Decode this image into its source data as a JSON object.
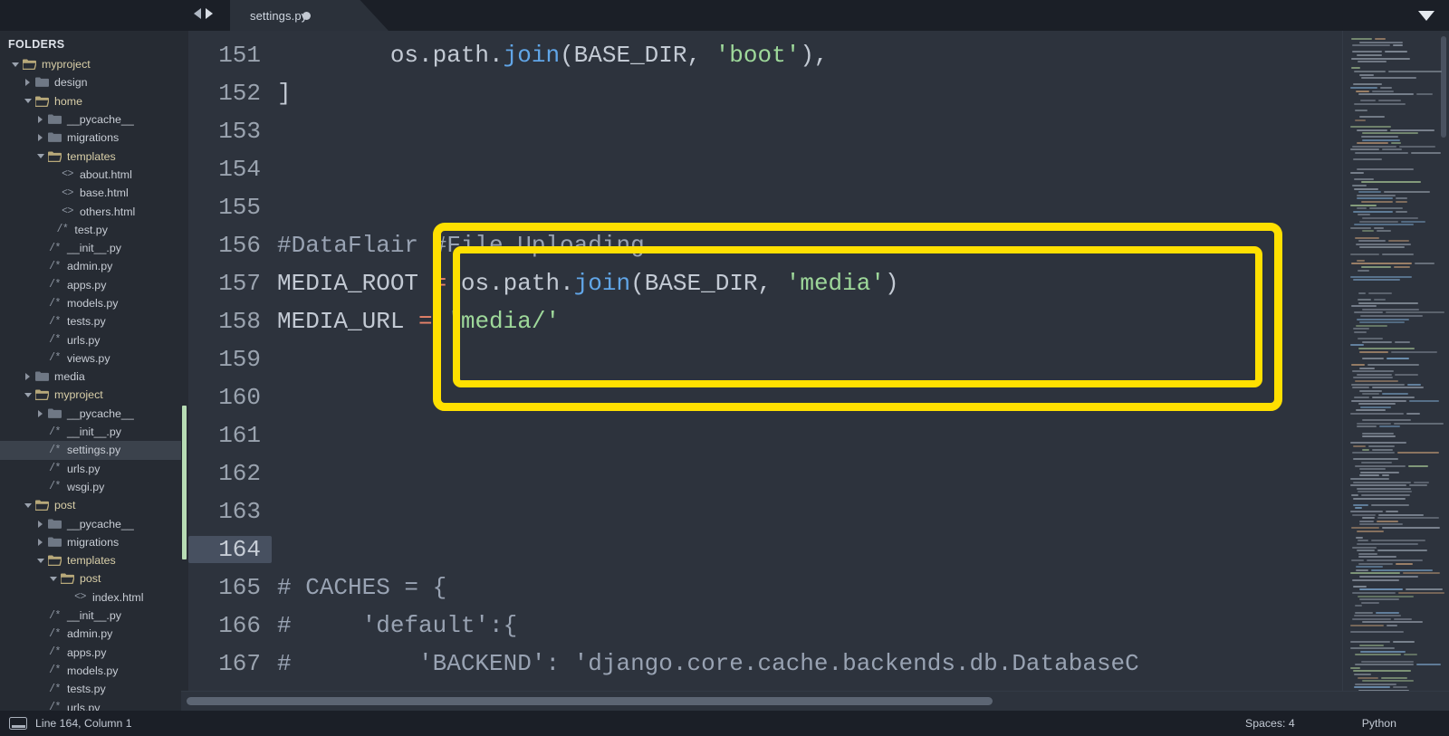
{
  "window": {
    "tab_label": "settings.py",
    "tab_modified_indicator": "unsaved-dot",
    "nav_back_icon": "arrow-left-icon",
    "nav_forward_icon": "arrow-right-icon",
    "menu_chevron_icon": "chevron-down-icon"
  },
  "sidebar": {
    "title": "FOLDERS",
    "items": [
      {
        "label": "myproject",
        "depth": 0,
        "kind": "folder",
        "state": "open",
        "icon": "folder-open-icon"
      },
      {
        "label": "design",
        "depth": 1,
        "kind": "folder",
        "state": "closed",
        "icon": "folder-icon"
      },
      {
        "label": "home",
        "depth": 1,
        "kind": "folder",
        "state": "open",
        "icon": "folder-open-icon"
      },
      {
        "label": "__pycache__",
        "depth": 2,
        "kind": "folder",
        "state": "closed",
        "icon": "folder-icon"
      },
      {
        "label": "migrations",
        "depth": 2,
        "kind": "folder",
        "state": "closed",
        "icon": "folder-icon"
      },
      {
        "label": "templates",
        "depth": 2,
        "kind": "folder",
        "state": "open",
        "icon": "folder-open-icon"
      },
      {
        "label": "about.html",
        "depth": 3,
        "kind": "file",
        "state": "",
        "icon": "html-file-icon"
      },
      {
        "label": "base.html",
        "depth": 3,
        "kind": "file",
        "state": "",
        "icon": "html-file-icon"
      },
      {
        "label": "others.html",
        "depth": 3,
        "kind": "file",
        "state": "",
        "icon": "html-file-icon"
      },
      {
        "label": "test.py",
        "depth": 2.6,
        "kind": "file",
        "state": "",
        "icon": "python-file-icon"
      },
      {
        "label": "__init__.py",
        "depth": 2,
        "kind": "file",
        "state": "",
        "icon": "python-file-icon"
      },
      {
        "label": "admin.py",
        "depth": 2,
        "kind": "file",
        "state": "",
        "icon": "python-file-icon"
      },
      {
        "label": "apps.py",
        "depth": 2,
        "kind": "file",
        "state": "",
        "icon": "python-file-icon"
      },
      {
        "label": "models.py",
        "depth": 2,
        "kind": "file",
        "state": "",
        "icon": "python-file-icon"
      },
      {
        "label": "tests.py",
        "depth": 2,
        "kind": "file",
        "state": "",
        "icon": "python-file-icon"
      },
      {
        "label": "urls.py",
        "depth": 2,
        "kind": "file",
        "state": "",
        "icon": "python-file-icon"
      },
      {
        "label": "views.py",
        "depth": 2,
        "kind": "file",
        "state": "",
        "icon": "python-file-icon"
      },
      {
        "label": "media",
        "depth": 1,
        "kind": "folder",
        "state": "closed",
        "icon": "folder-icon"
      },
      {
        "label": "myproject",
        "depth": 1,
        "kind": "folder",
        "state": "open",
        "icon": "folder-open-icon"
      },
      {
        "label": "__pycache__",
        "depth": 2,
        "kind": "folder",
        "state": "closed",
        "icon": "folder-icon"
      },
      {
        "label": "__init__.py",
        "depth": 2,
        "kind": "file",
        "state": "",
        "icon": "python-file-icon"
      },
      {
        "label": "settings.py",
        "depth": 2,
        "kind": "file",
        "state": "selected",
        "icon": "python-file-icon"
      },
      {
        "label": "urls.py",
        "depth": 2,
        "kind": "file",
        "state": "",
        "icon": "python-file-icon"
      },
      {
        "label": "wsgi.py",
        "depth": 2,
        "kind": "file",
        "state": "",
        "icon": "python-file-icon"
      },
      {
        "label": "post",
        "depth": 1,
        "kind": "folder",
        "state": "open",
        "icon": "folder-open-icon"
      },
      {
        "label": "__pycache__",
        "depth": 2,
        "kind": "folder",
        "state": "closed",
        "icon": "folder-icon"
      },
      {
        "label": "migrations",
        "depth": 2,
        "kind": "folder",
        "state": "closed",
        "icon": "folder-icon"
      },
      {
        "label": "templates",
        "depth": 2,
        "kind": "folder",
        "state": "open",
        "icon": "folder-open-icon"
      },
      {
        "label": "post",
        "depth": 3,
        "kind": "folder",
        "state": "open",
        "icon": "folder-open-icon"
      },
      {
        "label": "index.html",
        "depth": 4,
        "kind": "file",
        "state": "",
        "icon": "html-file-icon"
      },
      {
        "label": "__init__.py",
        "depth": 2,
        "kind": "file",
        "state": "",
        "icon": "python-file-icon"
      },
      {
        "label": "admin.py",
        "depth": 2,
        "kind": "file",
        "state": "",
        "icon": "python-file-icon"
      },
      {
        "label": "apps.py",
        "depth": 2,
        "kind": "file",
        "state": "",
        "icon": "python-file-icon"
      },
      {
        "label": "models.py",
        "depth": 2,
        "kind": "file",
        "state": "",
        "icon": "python-file-icon"
      },
      {
        "label": "tests.py",
        "depth": 2,
        "kind": "file",
        "state": "",
        "icon": "python-file-icon"
      },
      {
        "label": "urls.py",
        "depth": 2,
        "kind": "file",
        "state": "",
        "icon": "python-file-icon"
      }
    ]
  },
  "editor": {
    "current_line": 164,
    "first_visible_line": 151,
    "lines": [
      {
        "n": 151,
        "tokens": [
          {
            "t": "        os.path.",
            "c": "pln"
          },
          {
            "t": "join",
            "c": "fn"
          },
          {
            "t": "(BASE_DIR, ",
            "c": "pln"
          },
          {
            "t": "'boot'",
            "c": "str"
          },
          {
            "t": "),",
            "c": "pln"
          }
        ]
      },
      {
        "n": 152,
        "tokens": [
          {
            "t": "]",
            "c": "pln"
          }
        ]
      },
      {
        "n": 153,
        "tokens": []
      },
      {
        "n": 154,
        "tokens": []
      },
      {
        "n": 155,
        "tokens": []
      },
      {
        "n": 156,
        "tokens": [
          {
            "t": "#DataFlair #File Uploading",
            "c": "com"
          }
        ]
      },
      {
        "n": 157,
        "tokens": [
          {
            "t": "MEDIA_ROOT ",
            "c": "pln"
          },
          {
            "t": "=",
            "c": "op"
          },
          {
            "t": " os.path.",
            "c": "pln"
          },
          {
            "t": "join",
            "c": "fn"
          },
          {
            "t": "(BASE_DIR, ",
            "c": "pln"
          },
          {
            "t": "'media'",
            "c": "str"
          },
          {
            "t": ")",
            "c": "pln"
          }
        ]
      },
      {
        "n": 158,
        "tokens": [
          {
            "t": "MEDIA_URL ",
            "c": "pln"
          },
          {
            "t": "=",
            "c": "op"
          },
          {
            "t": " ",
            "c": "pln"
          },
          {
            "t": "'media/'",
            "c": "str"
          }
        ]
      },
      {
        "n": 159,
        "tokens": []
      },
      {
        "n": 160,
        "tokens": []
      },
      {
        "n": 161,
        "tokens": []
      },
      {
        "n": 162,
        "tokens": []
      },
      {
        "n": 163,
        "tokens": []
      },
      {
        "n": 164,
        "tokens": []
      },
      {
        "n": 165,
        "tokens": [
          {
            "t": "# CACHES = {",
            "c": "com"
          }
        ]
      },
      {
        "n": 166,
        "tokens": [
          {
            "t": "#     'default':{",
            "c": "com"
          }
        ]
      },
      {
        "n": 167,
        "tokens": [
          {
            "t": "#         'BACKEND': 'django.core.cache.backends.db.DatabaseC",
            "c": "com"
          }
        ]
      }
    ],
    "annotation": {
      "shape": "rounded-rectangle-double-border",
      "color": "#ffe000",
      "covers_lines": [
        156,
        157,
        158
      ]
    }
  },
  "statusbar": {
    "cursor_position": "Line 164, Column 1",
    "indentation": "Spaces: 4",
    "language": "Python",
    "screen_icon": "screen-icon"
  }
}
